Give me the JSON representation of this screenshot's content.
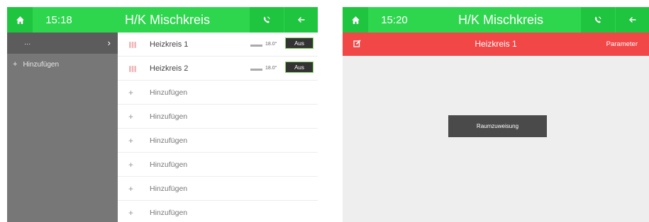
{
  "left": {
    "header": {
      "time": "15:18",
      "title": "H/K Mischkreis"
    },
    "sidebar": {
      "top_label": "...",
      "add_label": "Hinzufügen"
    },
    "circuits": [
      {
        "name": "Heizkreis 1",
        "temp": "18.0°",
        "button": "Aus"
      },
      {
        "name": "Heizkreis 2",
        "temp": "18.0°",
        "button": "Aus"
      }
    ],
    "add_rows": [
      "Hinzufügen",
      "Hinzufügen",
      "Hinzufügen",
      "Hinzufügen",
      "Hinzufügen",
      "Hinzufügen"
    ]
  },
  "right": {
    "header": {
      "time": "15:20",
      "title": "H/K Mischkreis"
    },
    "subheader": {
      "title": "Heizkreis 1",
      "parameter_label": "Parameter"
    },
    "room_button": "Raumzuweisung"
  },
  "colors": {
    "green": "#2ed64e",
    "green_dark": "#1fc43f",
    "red": "#f24747",
    "sidebar": "#777777"
  }
}
